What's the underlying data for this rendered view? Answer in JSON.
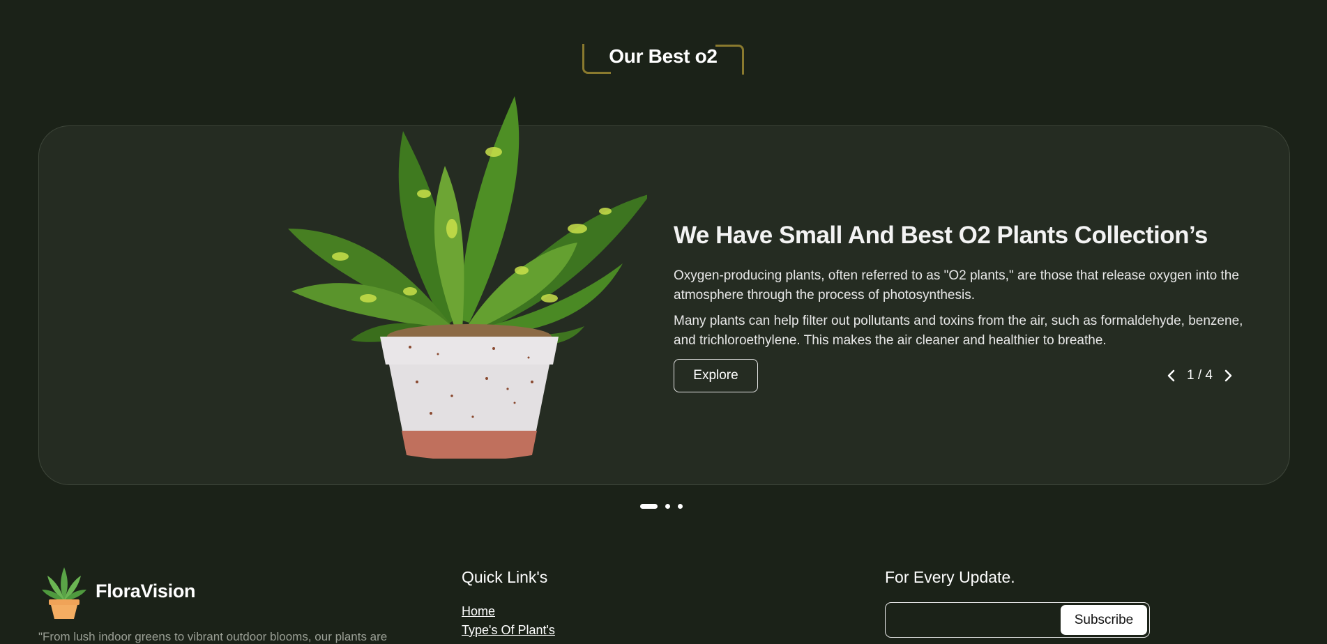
{
  "section": {
    "title": "Our Best o2"
  },
  "card": {
    "heading": "We Have Small And Best O2 Plants Collection’s",
    "paragraph1": "Oxygen-producing plants, often referred to as \"O2 plants,\" are those that release oxygen into the atmosphere through the process of photosynthesis.",
    "paragraph2": "Many plants can help filter out pollutants and toxins from the air, such as formaldehyde, benzene, and trichloroethylene. This makes the air cleaner and healthier to breathe.",
    "explore_label": "Explore",
    "pager": {
      "current": "1",
      "total": "4",
      "text": "1 / 4",
      "prev_icon": "chevron-left-icon",
      "next_icon": "chevron-right-icon"
    },
    "image": "potted-dieffenbachia-plant"
  },
  "carousel": {
    "dots": 3,
    "active_index": 0
  },
  "footer": {
    "brand": "FloraVision",
    "logo_icon": "potted-succulent-icon",
    "tagline": "\"From lush indoor greens to vibrant outdoor blooms, our plants are",
    "quick_links_heading": "Quick Link's",
    "quick_links": [
      "Home",
      "Type's Of Plant's"
    ],
    "update_heading": "For Every Update.",
    "subscribe_label": "Subscribe",
    "email_placeholder": ""
  },
  "colors": {
    "background": "#1b2218",
    "card": "#252c22",
    "accent_gold": "#8a7a2e",
    "plant_green": "#5a8f2a"
  }
}
